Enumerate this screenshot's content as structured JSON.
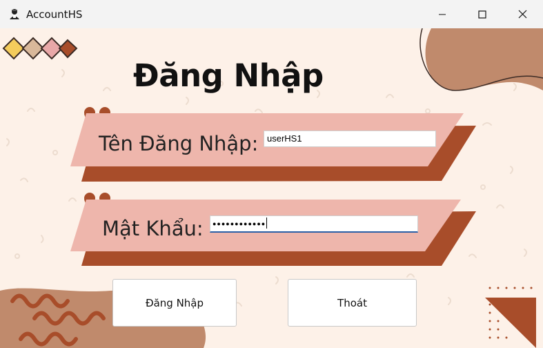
{
  "window": {
    "title": "AccountHS",
    "controls": [
      "minimize-icon",
      "maximize-icon",
      "close-icon"
    ]
  },
  "login": {
    "heading": "Đăng Nhập",
    "username_label": "Tên Đăng Nhập:",
    "username_value": "userHS1",
    "password_label": "Mật Khẩu:",
    "password_value": "●●●●●●●●●●●●"
  },
  "buttons": {
    "login_label": "Đăng Nhập",
    "exit_label": "Thoát"
  },
  "colors": {
    "background": "#fdf1e8",
    "banner_pink": "#eeb6ac",
    "banner_shadow": "#a84d2a",
    "blob_brown": "#c08a6c",
    "diamond_yellow": "#f4cc5c",
    "diamond_tan": "#d9b89a",
    "diamond_pink": "#e9a8a8",
    "diamond_rust": "#a84d2a"
  }
}
